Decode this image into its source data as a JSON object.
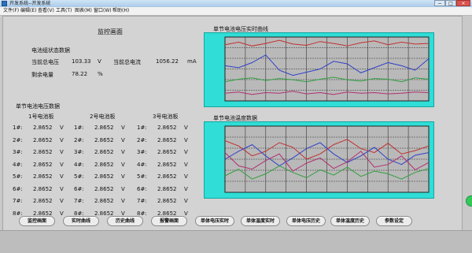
{
  "window": {
    "title": "开发系统--开发系统",
    "minimize": "−",
    "maximize": "□",
    "close": "×"
  },
  "menu": [
    "文件(F)",
    "编辑(E)",
    "查看(V)",
    "工具(T)",
    "图表(M)",
    "窗口(W)",
    "帮助(H)"
  ],
  "panel": {
    "title": "监控画面",
    "status_heading": "电池组状态数据",
    "total_voltage_label": "当前总电压",
    "total_voltage_value": "103.33",
    "total_voltage_unit": "V",
    "total_current_label": "当前总电流",
    "total_current_value": "1056.22",
    "total_current_unit": "mA",
    "remaining_label": "剩余电量",
    "remaining_value": "78.22",
    "remaining_unit": "%",
    "cell_voltage_heading": "单节电池电压数据"
  },
  "boards": [
    {
      "header": "1号电池板",
      "rows": [
        {
          "id": "1#:",
          "value": "2.8652",
          "unit": "V"
        },
        {
          "id": "2#:",
          "value": "2.8652",
          "unit": "V"
        },
        {
          "id": "3#:",
          "value": "2.8652",
          "unit": "V"
        },
        {
          "id": "4#:",
          "value": "2.8652",
          "unit": "V"
        },
        {
          "id": "5#:",
          "value": "2.8652",
          "unit": "V"
        },
        {
          "id": "6#:",
          "value": "2.8652",
          "unit": "V"
        },
        {
          "id": "7#:",
          "value": "2.8652",
          "unit": "V"
        },
        {
          "id": "8#:",
          "value": "2.8652",
          "unit": "V"
        }
      ]
    },
    {
      "header": "2号电池板",
      "rows": [
        {
          "id": "1#:",
          "value": "2.8652",
          "unit": "V"
        },
        {
          "id": "2#:",
          "value": "2.8652",
          "unit": "V"
        },
        {
          "id": "3#:",
          "value": "2.8652",
          "unit": "V"
        },
        {
          "id": "4#:",
          "value": "2.8652",
          "unit": "V"
        },
        {
          "id": "5#:",
          "value": "2.8652",
          "unit": "V"
        },
        {
          "id": "6#:",
          "value": "2.8652",
          "unit": "V"
        },
        {
          "id": "7#:",
          "value": "2.8652",
          "unit": "V"
        },
        {
          "id": "8#:",
          "value": "2.8652",
          "unit": "V"
        }
      ]
    },
    {
      "header": "3号电池板",
      "rows": [
        {
          "id": "1#:",
          "value": "2.8652",
          "unit": "V"
        },
        {
          "id": "2#:",
          "value": "2.8652",
          "unit": "V"
        },
        {
          "id": "3#:",
          "value": "2.8652",
          "unit": "V"
        },
        {
          "id": "4#:",
          "value": "2.8652",
          "unit": "V"
        },
        {
          "id": "5#:",
          "value": "2.8652",
          "unit": "V"
        },
        {
          "id": "6#:",
          "value": "2.8652",
          "unit": "V"
        },
        {
          "id": "7#:",
          "value": "2.8652",
          "unit": "V"
        },
        {
          "id": "8#:",
          "value": "2.8652",
          "unit": "V"
        }
      ]
    }
  ],
  "charts": [
    {
      "title": "单节电池电压实时曲线",
      "y_ticks": [
        "",
        "",
        "",
        ""
      ],
      "series": [
        {
          "color": "#c03030",
          "values": [
            0.88,
            0.92,
            0.86,
            0.9,
            0.95,
            0.89,
            0.87,
            0.93,
            0.9,
            0.86,
            0.91,
            0.94,
            0.88,
            0.92,
            0.89,
            0.9
          ]
        },
        {
          "color": "#3040c8",
          "values": [
            0.55,
            0.52,
            0.6,
            0.72,
            0.48,
            0.4,
            0.45,
            0.5,
            0.62,
            0.58,
            0.44,
            0.52,
            0.6,
            0.55,
            0.48,
            0.66
          ]
        },
        {
          "color": "#30a040",
          "values": [
            0.3,
            0.34,
            0.36,
            0.32,
            0.35,
            0.33,
            0.3,
            0.34,
            0.37,
            0.33,
            0.31,
            0.35,
            0.34,
            0.3,
            0.36,
            0.34
          ]
        },
        {
          "color": "#b03070",
          "values": [
            0.12,
            0.14,
            0.1,
            0.13,
            0.12,
            0.15,
            0.11,
            0.13,
            0.1,
            0.14,
            0.12,
            0.13,
            0.11,
            0.12,
            0.14,
            0.13
          ]
        }
      ]
    },
    {
      "title": "单节电池温度数据",
      "y_ticks": [
        "",
        "",
        ""
      ],
      "series": [
        {
          "color": "#c03030",
          "values": [
            0.78,
            0.7,
            0.55,
            0.62,
            0.75,
            0.68,
            0.5,
            0.58,
            0.72,
            0.8,
            0.66,
            0.6,
            0.74,
            0.58,
            0.63,
            0.7
          ]
        },
        {
          "color": "#3040c8",
          "values": [
            0.5,
            0.62,
            0.72,
            0.55,
            0.4,
            0.52,
            0.66,
            0.75,
            0.58,
            0.45,
            0.55,
            0.68,
            0.5,
            0.42,
            0.56,
            0.6
          ]
        },
        {
          "color": "#30a040",
          "values": [
            0.25,
            0.35,
            0.2,
            0.28,
            0.4,
            0.3,
            0.22,
            0.34,
            0.26,
            0.38,
            0.24,
            0.32,
            0.28,
            0.2,
            0.3,
            0.36
          ]
        },
        {
          "color": "#b03070",
          "values": [
            0.6,
            0.4,
            0.35,
            0.48,
            0.58,
            0.32,
            0.44,
            0.52,
            0.36,
            0.46,
            0.62,
            0.38,
            0.42,
            0.55,
            0.34,
            0.45
          ]
        }
      ]
    }
  ],
  "nav": [
    "监控画面",
    "实时曲线",
    "历史曲线",
    "报警画面",
    "单体电压实时",
    "单体温度实时",
    "单体电压历史",
    "单体温度历史",
    "参数设定"
  ]
}
